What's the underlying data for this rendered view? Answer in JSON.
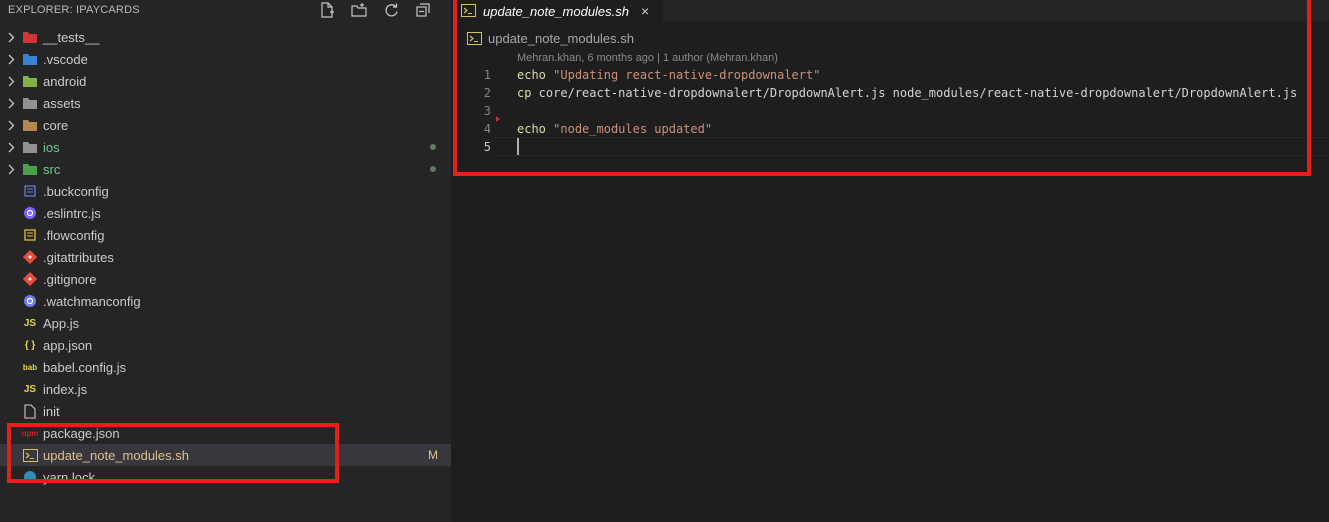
{
  "explorer": {
    "title": "EXPLORER: IPAYCARDS",
    "actions": [
      {
        "name": "new-file-icon"
      },
      {
        "name": "new-folder-icon"
      },
      {
        "name": "refresh-icon"
      },
      {
        "name": "collapse-all-icon"
      }
    ],
    "items": [
      {
        "label": "__tests__",
        "kind": "folder",
        "icon": "tests-folder-icon",
        "color": "#e0393e"
      },
      {
        "label": ".vscode",
        "kind": "folder",
        "icon": "vscode-folder-icon",
        "color": "#3b8eea"
      },
      {
        "label": "android",
        "kind": "folder",
        "icon": "android-folder-icon",
        "color": "#8bc34a"
      },
      {
        "label": "assets",
        "kind": "folder",
        "icon": "assets-folder-icon",
        "color": "#9e9e9e"
      },
      {
        "label": "core",
        "kind": "folder",
        "icon": "folder-icon",
        "color": "#c09553"
      },
      {
        "label": "ios",
        "kind": "folder",
        "icon": "ios-folder-icon",
        "color": "#9e9e9e",
        "git": "dot"
      },
      {
        "label": "src",
        "kind": "folder",
        "icon": "src-folder-icon",
        "color": "#4caf50",
        "git": "dot"
      },
      {
        "label": ".buckconfig",
        "kind": "file",
        "icon": "buck-icon",
        "color": "#6c7bd6"
      },
      {
        "label": ".eslintrc.js",
        "kind": "file",
        "icon": "eslint-icon",
        "color": "#7b61ff"
      },
      {
        "label": ".flowconfig",
        "kind": "file",
        "icon": "flow-icon",
        "color": "#e8bd36"
      },
      {
        "label": ".gitattributes",
        "kind": "file",
        "icon": "git-icon",
        "color": "#e44d3a"
      },
      {
        "label": ".gitignore",
        "kind": "file",
        "icon": "git-icon",
        "color": "#e44d3a"
      },
      {
        "label": ".watchmanconfig",
        "kind": "file",
        "icon": "watchman-icon",
        "color": "#6f7fe8"
      },
      {
        "label": "App.js",
        "kind": "file",
        "icon": "js-icon",
        "color": "#e8d44d"
      },
      {
        "label": "app.json",
        "kind": "file",
        "icon": "json-icon",
        "color": "#e8d44d"
      },
      {
        "label": "babel.config.js",
        "kind": "file",
        "icon": "babel-icon",
        "color": "#e8d44d"
      },
      {
        "label": "index.js",
        "kind": "file",
        "icon": "js-icon",
        "color": "#e8d44d"
      },
      {
        "label": "init",
        "kind": "file",
        "icon": "file-icon",
        "color": "#cccccc"
      },
      {
        "label": "package.json",
        "kind": "file",
        "icon": "npm-icon",
        "color": "#c12127"
      },
      {
        "label": "update_note_modules.sh",
        "kind": "file",
        "icon": "shell-icon",
        "color": "#d4c35a",
        "git": "M",
        "selected": true
      },
      {
        "label": "yarn.lock",
        "kind": "file",
        "icon": "yarn-icon",
        "color": "#2c8ebb"
      }
    ]
  },
  "editor": {
    "tab": {
      "label": "update_note_modules.sh",
      "close": "×"
    },
    "breadcrumb": "update_note_modules.sh",
    "blame": "Mehran.khan, 6 months ago | 1 author (Mehran.khan)",
    "lines": [
      {
        "num": "1",
        "cmd": "echo",
        "rest": " ",
        "str": "\"Updating react-native-dropdownalert\""
      },
      {
        "num": "2",
        "cmd": "cp",
        "rest": " core/react-native-dropdownalert/DropdownAlert.js node_modules/react-native-dropdownalert/DropdownAlert.js",
        "str": ""
      },
      {
        "num": "3",
        "cmd": "",
        "rest": "",
        "str": ""
      },
      {
        "num": "4",
        "cmd": "echo",
        "rest": " ",
        "str": "\"node_modules updated\""
      },
      {
        "num": "5",
        "cmd": "",
        "rest": "",
        "str": ""
      }
    ]
  },
  "colors": {
    "annotation_red": "#e3201b",
    "modified": "#e2c08d"
  }
}
